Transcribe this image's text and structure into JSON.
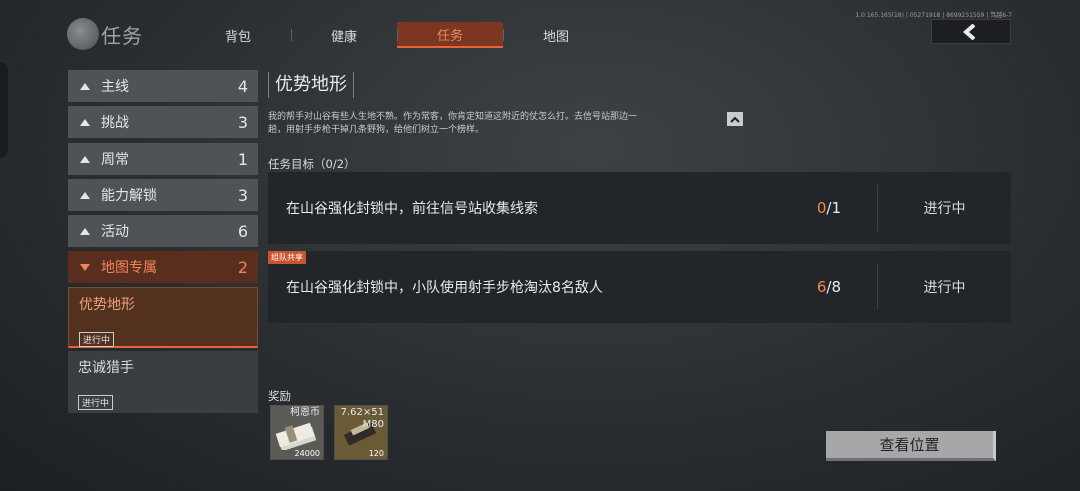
{
  "header": {
    "title": "任务",
    "tabs": [
      {
        "label": "背包",
        "active": false
      },
      {
        "label": "健康",
        "active": false
      },
      {
        "label": "任务",
        "active": true
      },
      {
        "label": "地图",
        "active": false
      }
    ],
    "version": "1.0.165.165(18) | 05271918 | 86992315S9 | 笃越6-7"
  },
  "sidebar": {
    "categories": [
      {
        "label": "主线",
        "count": "4"
      },
      {
        "label": "挑战",
        "count": "3"
      },
      {
        "label": "周常",
        "count": "1"
      },
      {
        "label": "能力解锁",
        "count": "3"
      },
      {
        "label": "活动",
        "count": "6"
      },
      {
        "label": "地图专属",
        "count": "2"
      }
    ],
    "quests": [
      {
        "name": "优势地形",
        "status": "进行中"
      },
      {
        "name": "忠诚猎手",
        "status": "进行中"
      }
    ]
  },
  "quest": {
    "title": "优势地形",
    "description_line1": "我的帮手对山谷有些人生地不熟。作为常客，你肯定知道这附近的仗怎么打。去信号站那边一",
    "description_line2": "趟，用射手步枪干掉几条野狗，给他们树立一个榜样。",
    "objectives_header": "任务目标（0/2）",
    "objectives": [
      {
        "text": "在山谷强化封锁中，前往信号站收集线索",
        "current": "0",
        "total": "/1",
        "status": "进行中"
      },
      {
        "text": "在山谷强化封锁中，小队使用射手步枪淘汰8名敌人",
        "current": "6",
        "total": "/8",
        "status": "进行中",
        "tag": "组队共享"
      }
    ],
    "reward_header": "奖励",
    "rewards": [
      {
        "label": "柯恩币",
        "quantity": "24000",
        "icon": "cash-bundle-icon"
      },
      {
        "label_line1": "7.62×51",
        "label_line2": "M80",
        "quantity": "120",
        "icon": "ammo-box-icon"
      }
    ],
    "view_location_label": "查看位置"
  }
}
